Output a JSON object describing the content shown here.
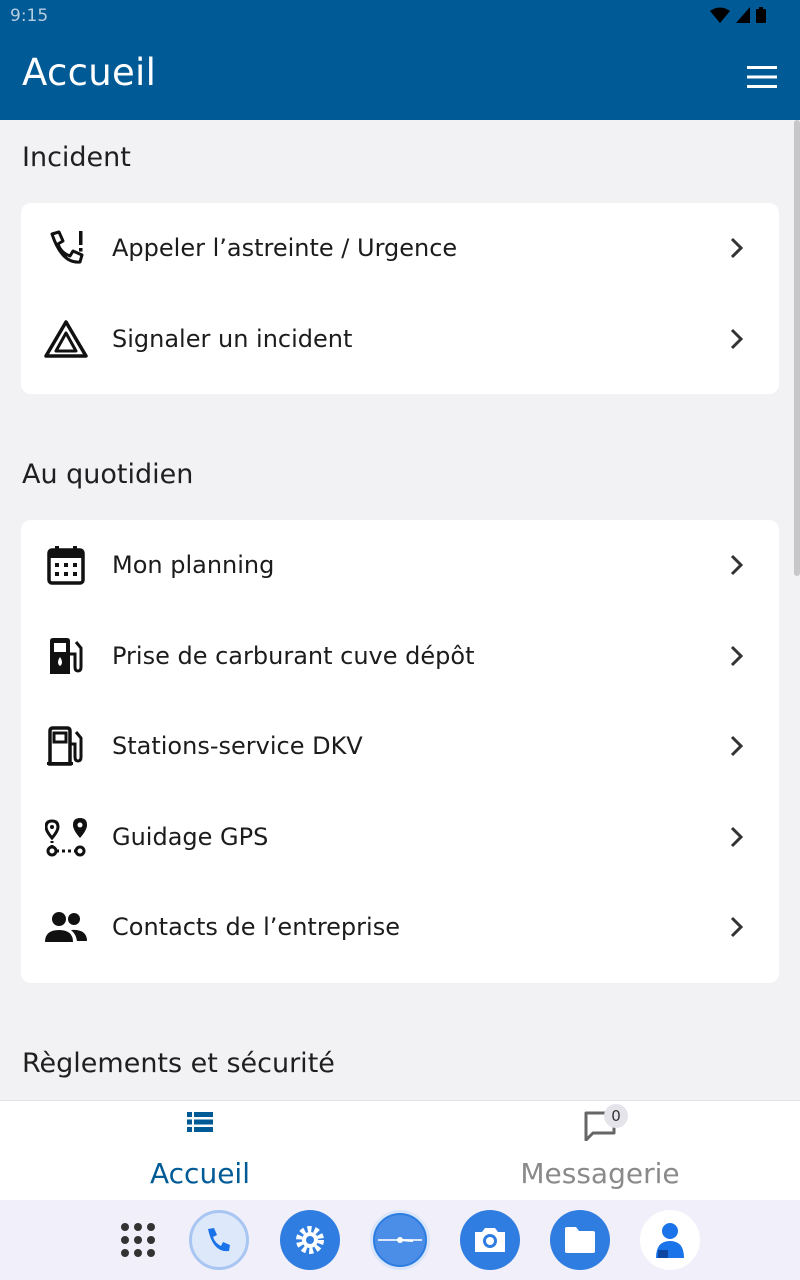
{
  "status_bar": {
    "time": "9:15"
  },
  "app_bar": {
    "title": "Accueil",
    "menu_icon": "hamburger-menu-icon"
  },
  "sections": [
    {
      "title": "Incident",
      "items": [
        {
          "label": "Appeler l’astreinte / Urgence",
          "icon": "phone-alert-icon"
        },
        {
          "label": "Signaler un incident",
          "icon": "warning-triangle-icon"
        }
      ]
    },
    {
      "title": "Au quotidien",
      "items": [
        {
          "label": "Mon planning",
          "icon": "calendar-icon"
        },
        {
          "label": "Prise de carburant cuve dépôt",
          "icon": "fuel-pump-icon"
        },
        {
          "label": "Stations-service DKV",
          "icon": "gas-station-icon"
        },
        {
          "label": "Guidage GPS",
          "icon": "route-pin-icon"
        },
        {
          "label": "Contacts de l’entreprise",
          "icon": "people-icon"
        }
      ]
    },
    {
      "title": "Règlements et sécurité",
      "items": []
    }
  ],
  "bottom_nav": {
    "tabs": [
      {
        "label": "Accueil",
        "icon": "list-icon",
        "active": true
      },
      {
        "label": "Messagerie",
        "icon": "chat-bubble-icon",
        "active": false,
        "badge": "0"
      }
    ]
  },
  "dock": {
    "apps": [
      "app-grid-icon",
      "phone-icon",
      "settings-icon",
      "clock-icon",
      "camera-icon",
      "files-icon",
      "contacts-icon"
    ]
  },
  "colors": {
    "primary": "#005a96",
    "background": "#f2f2f4",
    "card": "#ffffff"
  }
}
